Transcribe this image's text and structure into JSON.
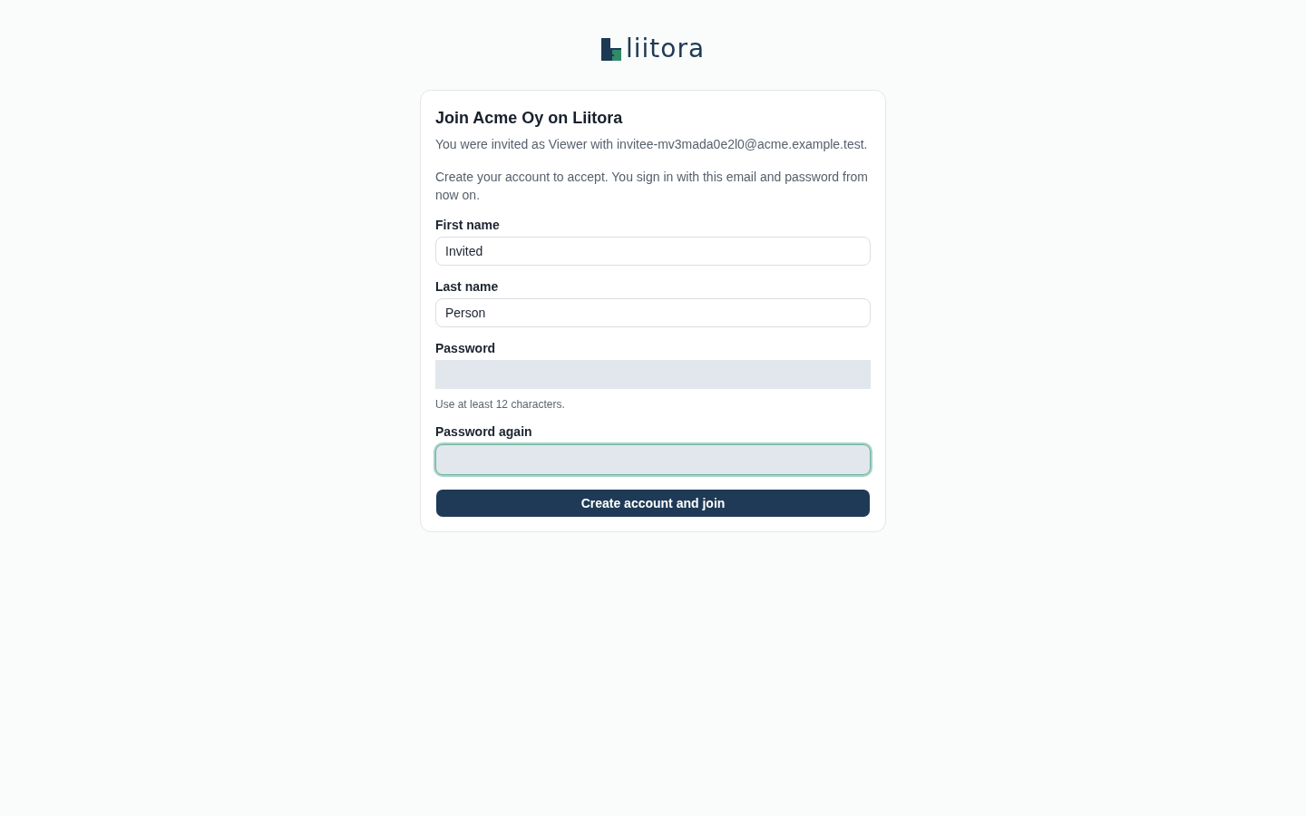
{
  "logo": {
    "wordmark": "liitora"
  },
  "card": {
    "title": "Join Acme Oy on Liitora",
    "paragraphs": [
      "You were invited as Viewer with invitee-mv3mada0e2l0@acme.example.test.",
      "Create your account to accept. You sign in with this email and password from now on."
    ],
    "fields": [
      {
        "label": "First name",
        "kind": "text",
        "value": "Invited",
        "focused": false
      },
      {
        "label": "Last name",
        "kind": "text",
        "value": "Person",
        "focused": false
      },
      {
        "label": "Password",
        "kind": "password",
        "hint": "Use at least 12 characters.",
        "focused": false
      },
      {
        "label": "Password again",
        "kind": "password",
        "focused": true
      }
    ],
    "submit": "Create account and join"
  }
}
